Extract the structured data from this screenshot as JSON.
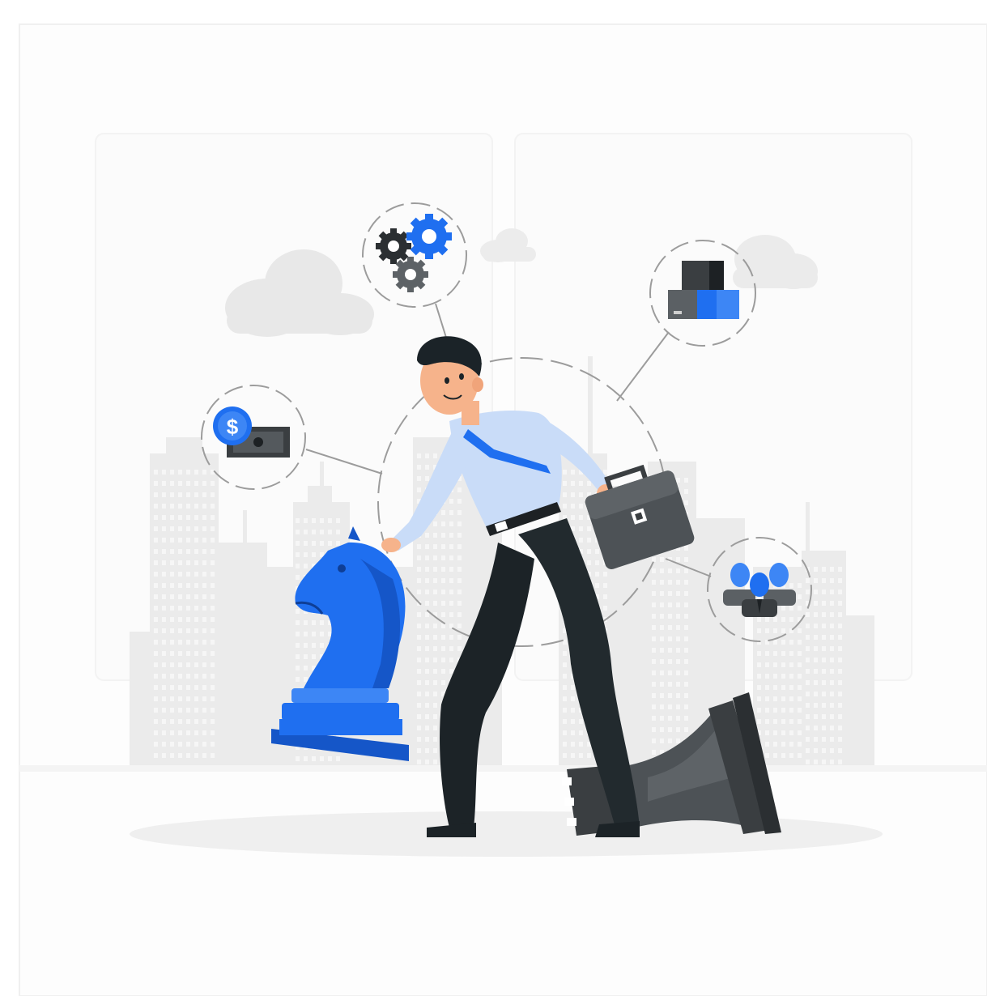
{
  "illustration": {
    "money_symbol": "$"
  },
  "colors": {
    "background": "#ffffff",
    "frame_border": "#f2f2f2",
    "city": "#ececec",
    "city_window": "#f7f7f7",
    "cloud": "#e6e6e6",
    "dashed_ring": "#9a9a9a",
    "accent_blue": "#1f6ff0",
    "accent_blue_dark": "#1556c8",
    "dark_gray": "#3f4346",
    "mid_gray": "#5a5f63",
    "shirt": "#c9dcf8",
    "pants": "#222a2e",
    "skin": "#f6b38b",
    "hair": "#1b2328",
    "ground": "#f0f0f0"
  },
  "icons": [
    "gears-icon",
    "inventory-boxes-icon",
    "money-coin-icon",
    "team-people-icon",
    "briefcase-icon",
    "chess-knight-icon",
    "chess-rook-icon",
    "cloud-icon"
  ]
}
